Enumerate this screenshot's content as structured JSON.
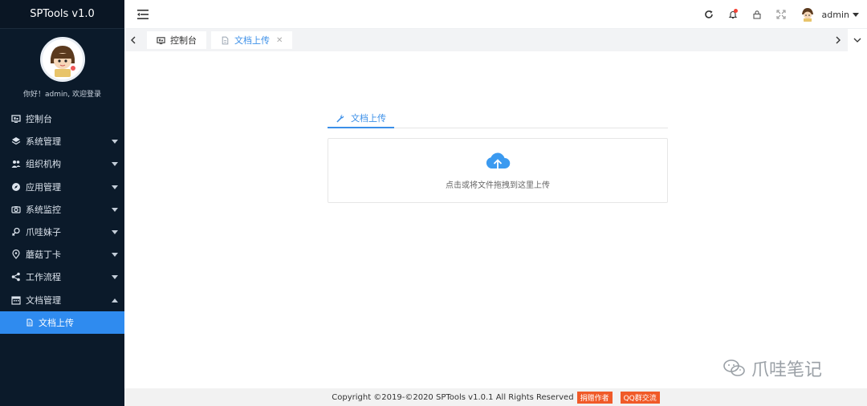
{
  "app": {
    "title": "SPTools v1.0"
  },
  "sidebar": {
    "welcome": "你好！admin, 欢迎登录",
    "items": [
      {
        "label": "控制台",
        "icon": "monitor-icon",
        "caret": ""
      },
      {
        "label": "系统管理",
        "icon": "layers-icon",
        "caret": "down"
      },
      {
        "label": "组织机构",
        "icon": "users-icon",
        "caret": "down"
      },
      {
        "label": "应用管理",
        "icon": "compass-icon",
        "caret": "down"
      },
      {
        "label": "系统监控",
        "icon": "camera-icon",
        "caret": "down"
      },
      {
        "label": "爪哇妹子",
        "icon": "female-icon",
        "caret": "down"
      },
      {
        "label": "蘑菇丁卡",
        "icon": "location-pin-icon",
        "caret": "down"
      },
      {
        "label": "工作流程",
        "icon": "share-icon",
        "caret": "down"
      },
      {
        "label": "文档管理",
        "icon": "calendar-icon",
        "caret": "up"
      }
    ],
    "subitem": {
      "label": "文档上传",
      "icon": "file-icon"
    }
  },
  "header": {
    "user_name": "admin",
    "icons": [
      "refresh-icon",
      "bell-icon",
      "lock-icon",
      "fullscreen-icon"
    ]
  },
  "tabs": [
    {
      "label": "控制台",
      "icon": "monitor-icon",
      "active": false
    },
    {
      "label": "文档上传",
      "icon": "file-icon",
      "active": true
    }
  ],
  "upload": {
    "tab_label": "文档上传",
    "hint": "点击或将文件拖拽到这里上传"
  },
  "footer": {
    "copyright": "Copyright ©2019-©2020 SPTools v1.0.1 All Rights Reserved",
    "tag_donate": "捐赠作者",
    "tag_qq": "QQ群交流"
  },
  "watermark": {
    "text": "爪哇笔记"
  },
  "colors": {
    "sidebar_bg": "#0b1a2a",
    "accent": "#2f8bef",
    "tag": "#f05a28"
  }
}
